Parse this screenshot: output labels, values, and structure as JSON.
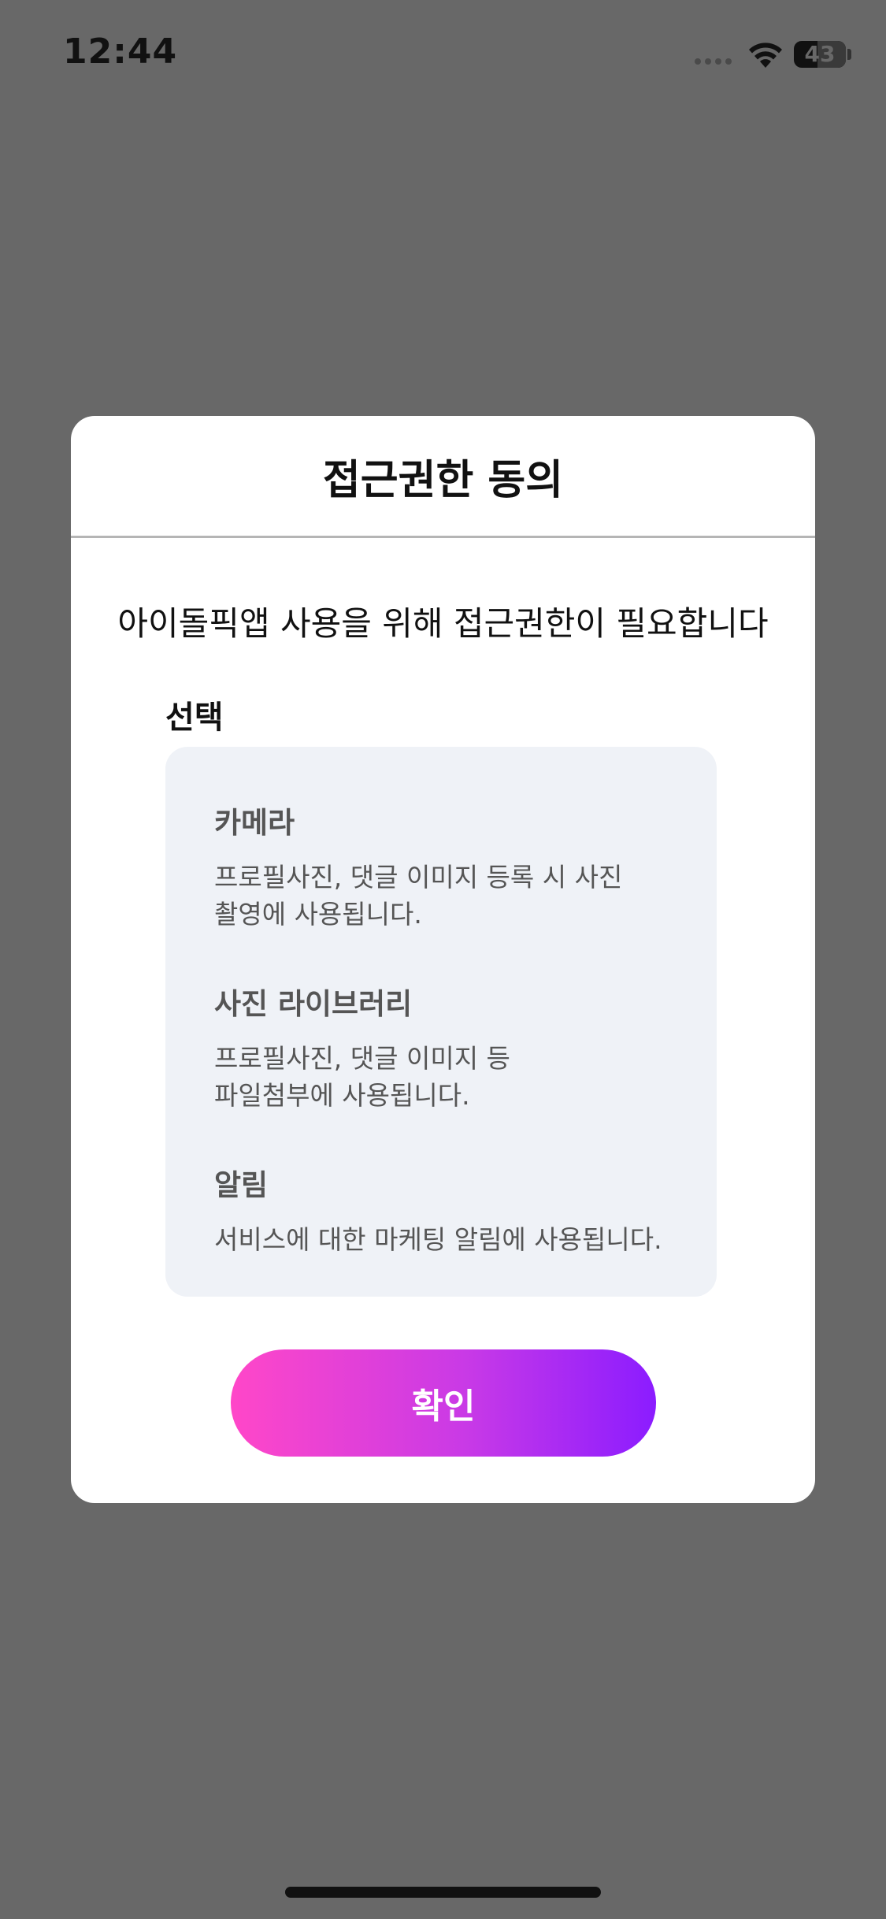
{
  "status_bar": {
    "time": "12:44",
    "battery": "43",
    "icons": [
      "signal-icon",
      "wifi-icon",
      "battery-icon"
    ]
  },
  "modal": {
    "title": "접근권한 동의",
    "message": "아이돌픽앱 사용을 위해 접근권한이 필요합니다",
    "section_label": "선택",
    "permissions": [
      {
        "title": "카메라",
        "desc_line1": "프로필사진, 댓글 이미지 등록 시 사진",
        "desc_line2": "촬영에 사용됩니다."
      },
      {
        "title": "사진 라이브러리",
        "desc_line1": "프로필사진, 댓글 이미지 등",
        "desc_line2": "파일첨부에 사용됩니다."
      },
      {
        "title": "알림",
        "desc_line1": "서비스에 대한 마케팅 알림에 사용됩니다."
      }
    ],
    "confirm_label": "확인"
  },
  "colors": {
    "overlay": "#686868",
    "modal_bg": "#ffffff",
    "perm_box_bg": "#eff2f7",
    "button_gradient_start": "#ff47c8",
    "button_gradient_end": "#8b1cff"
  }
}
